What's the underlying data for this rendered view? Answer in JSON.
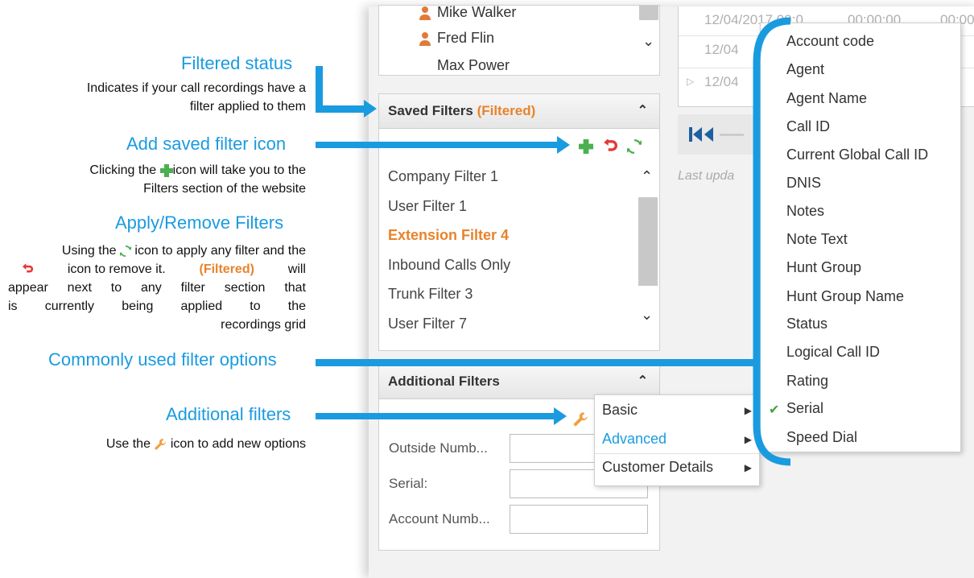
{
  "annotations": {
    "filtered_status": {
      "title": "Filtered status",
      "desc_line1": "Indicates if your call recordings have a",
      "desc_line2": "filter applied to them"
    },
    "add_saved_filter": {
      "title": "Add saved filter icon",
      "desc_before": "Clicking the",
      "desc_after": "icon will take you to the",
      "desc_line2": "Filters section of the website"
    },
    "apply_remove": {
      "title": "Apply/Remove Filters",
      "l1_before": "Using the",
      "l1_after": "icon to apply any filter and the",
      "l2_after": "icon to remove it.",
      "l2_hl": "(Filtered)",
      "l2_end": "will",
      "l3": "appear next to any filter section that",
      "l4": "is currently being applied to the",
      "l5": "recordings grid"
    },
    "common_options": {
      "title": "Commonly used filter options"
    },
    "additional_filters": {
      "title": "Additional filters",
      "desc_before": "Use the",
      "desc_after": "icon to add new options"
    }
  },
  "agents": [
    "Mike Walker",
    "Fred Flin",
    "Max Power"
  ],
  "saved_filters": {
    "title": "Saved Filters",
    "status": "(Filtered)",
    "items": [
      {
        "label": "Company Filter 1",
        "active": false
      },
      {
        "label": "User Filter 1",
        "active": false
      },
      {
        "label": "Extension Filter 4",
        "active": true
      },
      {
        "label": "Inbound Calls Only",
        "active": false
      },
      {
        "label": "Trunk Filter 3",
        "active": false
      },
      {
        "label": "User Filter 7",
        "active": false
      }
    ]
  },
  "additional_filters": {
    "title": "Additional Filters",
    "fields": [
      {
        "label": "Outside Numb...",
        "value": ""
      },
      {
        "label": "Serial:",
        "value": ""
      },
      {
        "label": "Account Numb...",
        "value": ""
      }
    ]
  },
  "add_menu": {
    "items": [
      {
        "label": "Basic",
        "highlighted": false
      },
      {
        "label": "Advanced",
        "highlighted": true
      },
      {
        "label": "Customer Details",
        "highlighted": false
      }
    ]
  },
  "grid": {
    "row1_date": "12/04/2017 09:0...",
    "row1_duration": "00:00:00",
    "row1_extra": "00:00",
    "row2_date": "12/04",
    "row3_date": "12/04",
    "last_updated": "Last upda"
  },
  "column_menu": {
    "items": [
      {
        "label": "Account code",
        "checked": false
      },
      {
        "label": "Agent",
        "checked": false
      },
      {
        "label": "Agent Name",
        "checked": false
      },
      {
        "label": "Call ID",
        "checked": false
      },
      {
        "label": "Current Global Call ID",
        "checked": false
      },
      {
        "label": "DNIS",
        "checked": false
      },
      {
        "label": "Notes",
        "checked": false
      },
      {
        "label": "Note Text",
        "checked": false
      },
      {
        "label": "Hunt Group",
        "checked": false
      },
      {
        "label": "Hunt Group Name",
        "checked": false
      },
      {
        "label": "Status",
        "checked": false
      },
      {
        "label": "Logical Call ID",
        "checked": false
      },
      {
        "label": "Rating",
        "checked": false
      },
      {
        "label": "Serial",
        "checked": true
      },
      {
        "label": "Speed Dial",
        "checked": false
      }
    ]
  },
  "colors": {
    "annotation_blue": "#1a9be0",
    "filtered_orange": "#e8832a",
    "check_green": "#43a047"
  }
}
